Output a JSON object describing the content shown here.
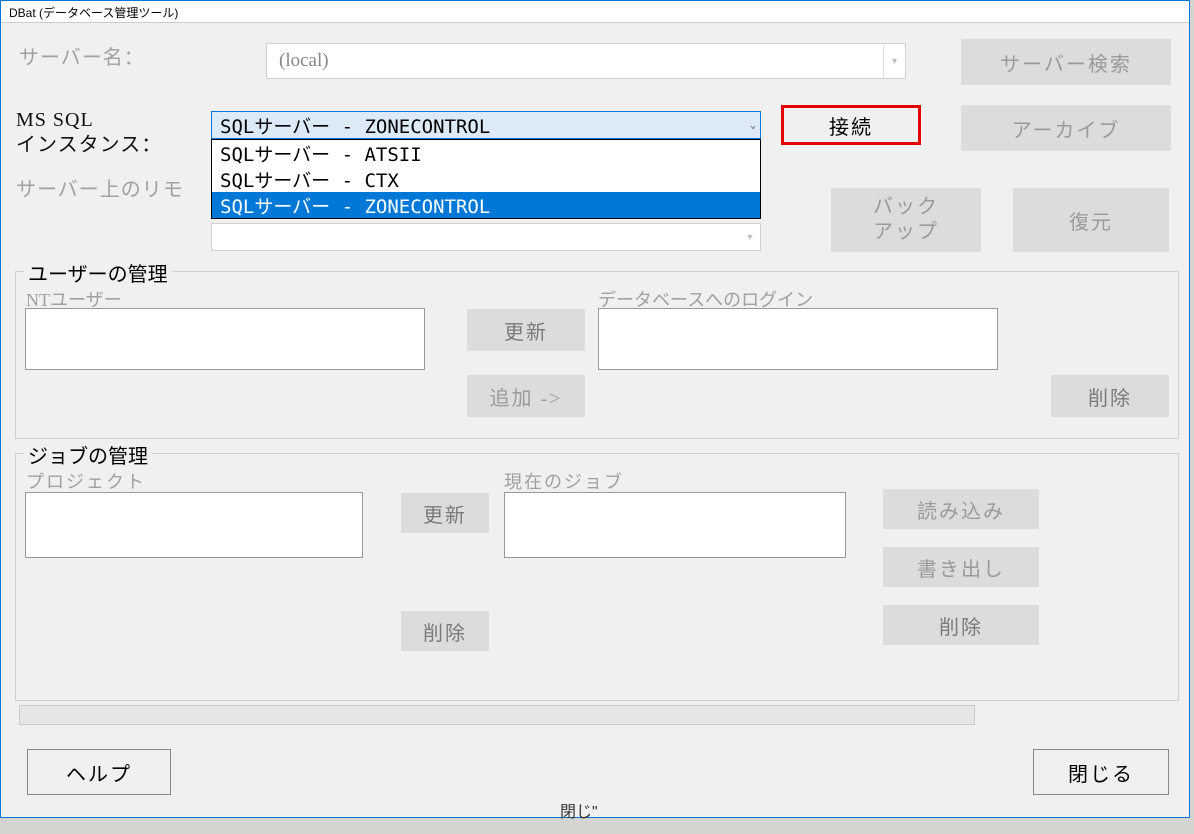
{
  "window": {
    "title": "DBat (データベース管理ツール)"
  },
  "labels": {
    "server_name": "サーバー名：",
    "mssql_instance_line1": "MS SQL",
    "mssql_instance_line2": "インスタンス：",
    "remote": "サーバー上のリモ",
    "user_mgmt_title": "ユーザーの管理",
    "nt_user": "NTユーザー",
    "db_login": "データベースへのログイン",
    "job_mgmt_title": "ジョブの管理",
    "project": "プロジェクト",
    "current_job": "現在のジョブ"
  },
  "server_name_combo": {
    "value": "(local)"
  },
  "instance_combo": {
    "value": "SQLサーバー - ZONECONTROL",
    "options": [
      "SQLサーバー - ATSII",
      "SQLサーバー - CTX",
      "SQLサーバー - ZONECONTROL"
    ],
    "selected_index": 2
  },
  "buttons": {
    "server_search": "サーバー検索",
    "connect": "接続",
    "archive": "アーカイブ",
    "backup_line1": "バック",
    "backup_line2": "アップ",
    "restore": "復元",
    "update": "更新",
    "add": "追加 ->",
    "delete": "削除",
    "load": "読み込み",
    "export": "書き出し",
    "help": "ヘルプ",
    "close": "閉じる"
  },
  "bottom_fragment": "閉じ\""
}
